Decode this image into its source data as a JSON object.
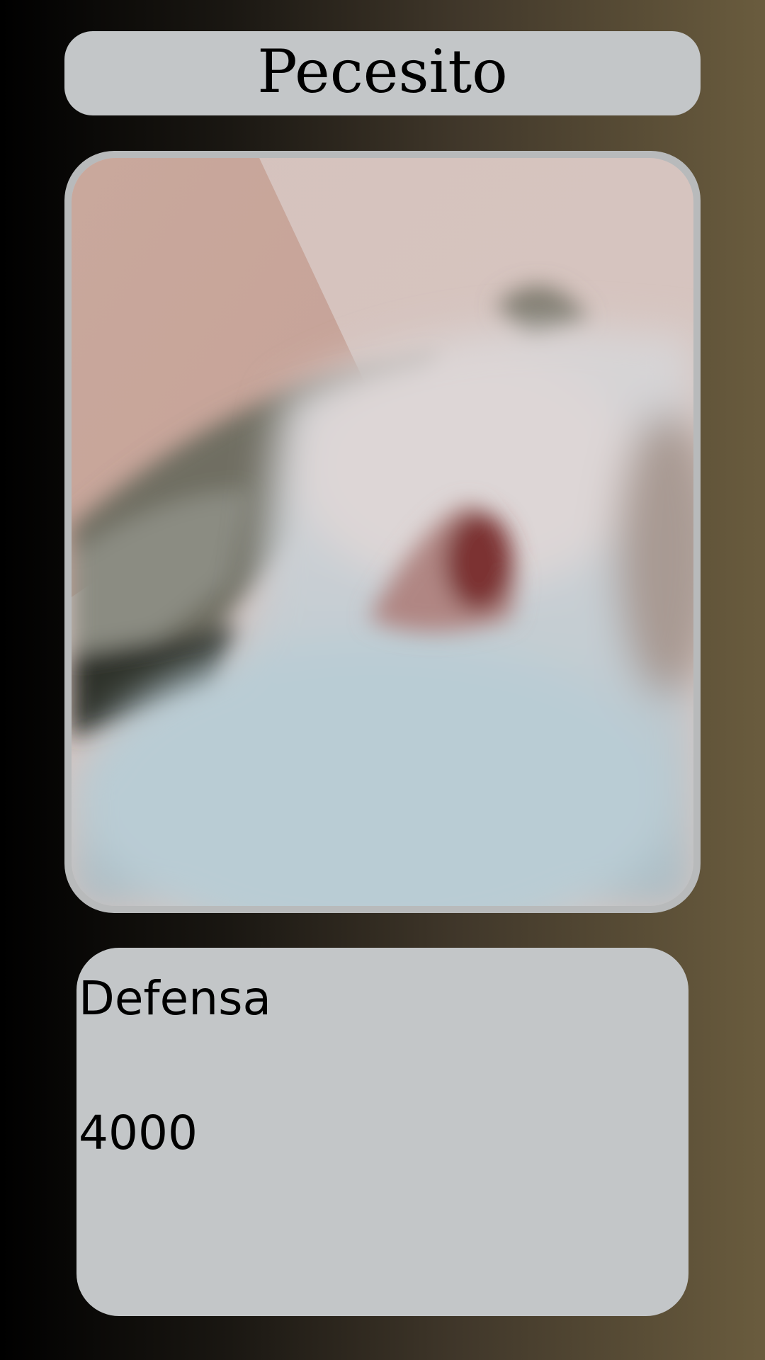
{
  "card": {
    "title": "Pecesito",
    "photo_icon": "cat-photo",
    "stat_label": "Defensa",
    "stat_value": "4000"
  },
  "colors": {
    "background_left": "#000000",
    "background_right": "#6a5c3e",
    "panel": "#c3c6c8",
    "photo_border": "#b8babb"
  }
}
